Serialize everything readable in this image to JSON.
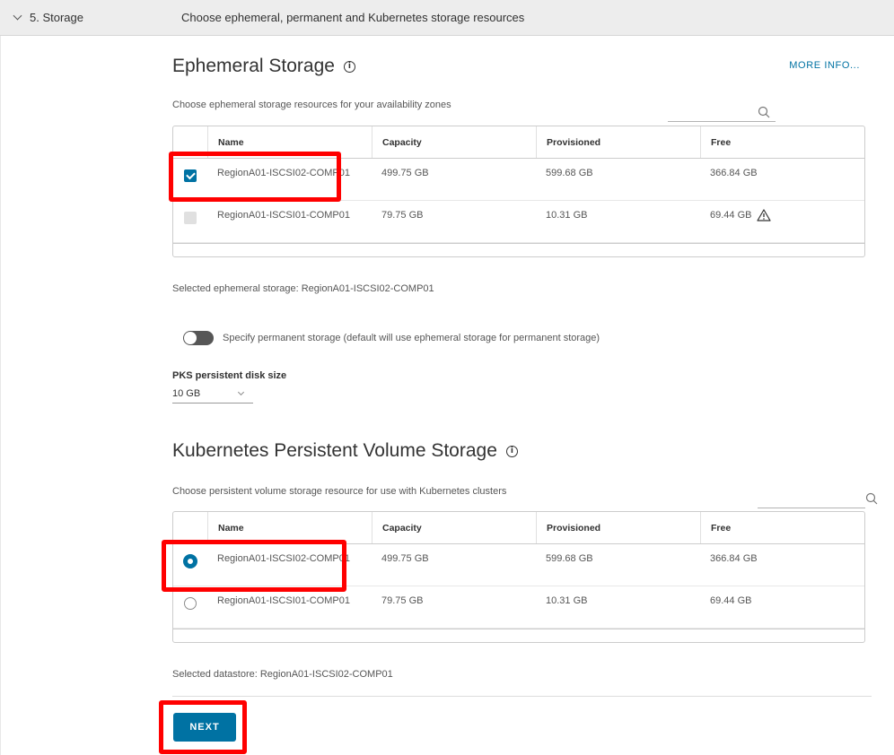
{
  "step": {
    "label": "5. Storage",
    "description": "Choose ephemeral, permanent and Kubernetes storage resources"
  },
  "ephemeral": {
    "title": "Ephemeral Storage",
    "more_info": "MORE INFO...",
    "subtitle": "Choose ephemeral storage resources for your availability zones",
    "columns": {
      "name": "Name",
      "capacity": "Capacity",
      "provisioned": "Provisioned",
      "free": "Free"
    },
    "rows": [
      {
        "name": "RegionA01-ISCSI02-COMP01",
        "capacity": "499.75 GB",
        "provisioned": "599.68 GB",
        "free": "366.84 GB",
        "selected": true,
        "warning": false
      },
      {
        "name": "RegionA01-ISCSI01-COMP01",
        "capacity": "79.75 GB",
        "provisioned": "10.31 GB",
        "free": "69.44 GB",
        "selected": false,
        "warning": true
      }
    ],
    "selected_text": "Selected ephemeral storage: RegionA01-ISCSI02-COMP01"
  },
  "permanent": {
    "toggle_label": "Specify permanent storage (default will use ephemeral storage for permanent storage)",
    "toggle_on": false,
    "disk_label": "PKS persistent disk size",
    "disk_value": "10 GB"
  },
  "kubernetes": {
    "title": "Kubernetes Persistent Volume Storage",
    "subtitle": "Choose persistent volume storage resource for use with Kubernetes clusters",
    "columns": {
      "name": "Name",
      "capacity": "Capacity",
      "provisioned": "Provisioned",
      "free": "Free"
    },
    "rows": [
      {
        "name": "RegionA01-ISCSI02-COMP01",
        "capacity": "499.75 GB",
        "provisioned": "599.68 GB",
        "free": "366.84 GB",
        "selected": true
      },
      {
        "name": "RegionA01-ISCSI01-COMP01",
        "capacity": "79.75 GB",
        "provisioned": "10.31 GB",
        "free": "69.44 GB",
        "selected": false
      }
    ],
    "selected_text": "Selected datastore: RegionA01-ISCSI02-COMP01"
  },
  "actions": {
    "next": "NEXT"
  },
  "colors": {
    "accent": "#0072a3",
    "highlight": "#ff0000",
    "header_bg": "#ededed"
  }
}
